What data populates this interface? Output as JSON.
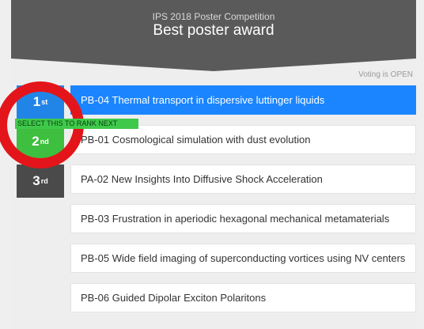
{
  "header": {
    "subtitle": "IPS 2018 Poster Competition",
    "title": "Best poster award"
  },
  "voting_status": "Voting is OPEN",
  "ranks": [
    {
      "num": "1",
      "suffix": "st"
    },
    {
      "num": "2",
      "suffix": "nd"
    },
    {
      "num": "3",
      "suffix": "rd"
    }
  ],
  "hint": "SELECT THIS TO RANK NEXT",
  "posters": [
    "PB-04 Thermal transport in dispersive luttinger liquids",
    "PB-01 Cosmological simulation with dust evolution",
    "PA-02 New Insights Into Diffusive Shock Acceleration",
    "PB-03 Frustration in aperiodic hexagonal mechanical metamaterials",
    "PB-05 Wide field imaging of superconducting vortices using NV centers",
    "PB-06 Guided Dipolar Exciton Polaritons"
  ],
  "colors": {
    "accent": "#1a85ff",
    "rank_next": "#3fbf3f",
    "highlight_ring": "#e3151a",
    "header_bg": "#5a5a5a"
  }
}
